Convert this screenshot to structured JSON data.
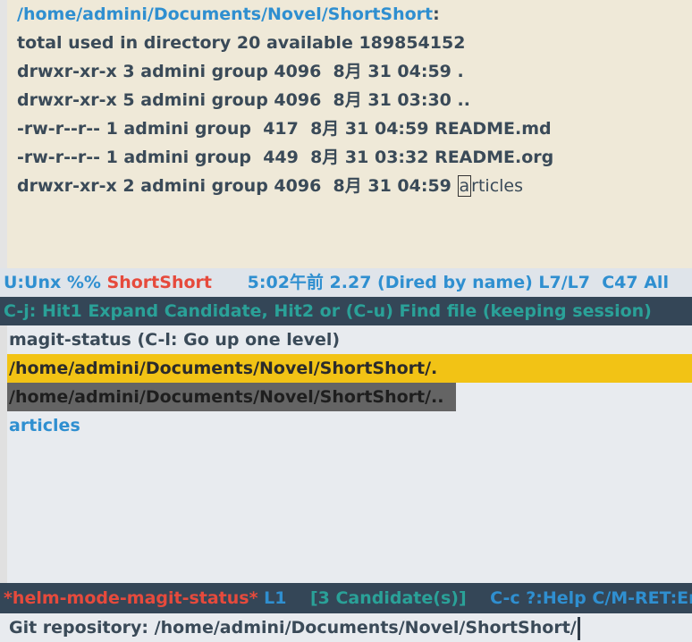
{
  "dired": {
    "header_path": "/home/admini/Documents/Novel/ShortShort",
    "header_colon": ":",
    "total": "total used in directory 20 available 189854152",
    "entries": [
      "drwxr-xr-x 3 admini group 4096  8月 31 04:59 .",
      "drwxr-xr-x 5 admini group 4096  8月 31 03:30 ..",
      "-rw-r--r-- 1 admini group  417  8月 31 04:59 README.md",
      "-rw-r--r-- 1 admini group  449  8月 31 03:32 README.org"
    ],
    "last_prefix": "drwxr-xr-x 2 admini group 4096  8月 31 04:59 ",
    "last_cursor_char": "a",
    "last_rest": "rticles"
  },
  "modeline1": {
    "encoding": "U:Unx %% ",
    "buffer": "ShortShort",
    "info": "      5:02午前 2.27 (Dired by name) L7/L7  C47 All"
  },
  "helm": {
    "header": "C-j: Hit1 Expand Candidate, Hit2 or (C-u) Find file (keeping session)",
    "action_line": "magit-status (C-l: Go up one level)",
    "candidates": [
      "/home/admini/Documents/Novel/ShortShort/.",
      "/home/admini/Documents/Novel/ShortShort/..",
      "articles"
    ]
  },
  "modeline2": {
    "buffer": "*helm-mode-magit-status*",
    "line": " L1",
    "candidates": "    [3 Candidate(s)]",
    "help": "    C-c ?:Help C/M-RET:Empty"
  },
  "minibuffer": {
    "prompt": "Git repository: ",
    "value": "/home/admini/Documents/Novel/ShortShort/"
  },
  "colors": {
    "accent_blue": "#2f8fd0",
    "buffer_red": "#e64a3c",
    "selection_yellow": "#f2c315",
    "helm_header_bg": "#344657",
    "teal": "#2aa198"
  }
}
